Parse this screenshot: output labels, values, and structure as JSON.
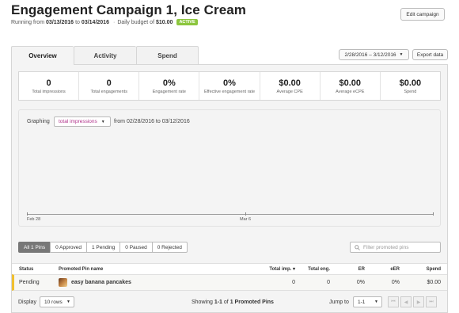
{
  "header": {
    "title": "Engagement Campaign 1, Ice Cream",
    "running_prefix": "Running from",
    "start_date": "03/13/2016",
    "to_word": "to",
    "end_date": "03/14/2016",
    "separator": "·",
    "budget_prefix": "Daily budget of",
    "budget": "$10.00",
    "status_badge": "ACTIVE",
    "edit_button": "Edit campaign"
  },
  "tabs": [
    {
      "label": "Overview",
      "active": true
    },
    {
      "label": "Activity",
      "active": false
    },
    {
      "label": "Spend",
      "active": false
    }
  ],
  "toolbar": {
    "date_range": "2/28/2016 – 3/12/2016",
    "export_button": "Export data"
  },
  "stats": [
    {
      "value": "0",
      "label": "Total impressions"
    },
    {
      "value": "0",
      "label": "Total engagements"
    },
    {
      "value": "0%",
      "label": "Engagement rate"
    },
    {
      "value": "0%",
      "label": "Effective engagement rate"
    },
    {
      "value": "$0.00",
      "label": "Average CPE"
    },
    {
      "value": "$0.00",
      "label": "Average eCPE"
    },
    {
      "value": "$0.00",
      "label": "Spend"
    }
  ],
  "graph": {
    "label": "Graphing",
    "metric": "total impressions",
    "range_text": "from 02/28/2016 to 03/12/2016",
    "x_ticks": [
      "Feb 28",
      "Mar 6"
    ]
  },
  "filters": {
    "buttons": [
      "All 1 Pins",
      "0 Approved",
      "1 Pending",
      "0 Paused",
      "0 Rejected"
    ],
    "search_placeholder": "Filter promoted pins"
  },
  "table": {
    "columns": [
      "Status",
      "Promoted Pin name",
      "Total imp. ▾",
      "Total eng.",
      "ER",
      "eER",
      "Spend"
    ],
    "rows": [
      {
        "status": "Pending",
        "name": "easy banana pancakes",
        "impressions": "0",
        "engagements": "0",
        "er": "0%",
        "eer": "0%",
        "spend": "$0.00"
      }
    ]
  },
  "footer": {
    "display_label": "Display",
    "rows_option": "10 rows",
    "showing_prefix": "Showing",
    "showing_range": "1-1",
    "showing_of": "of",
    "showing_count": "1",
    "showing_suffix": "Promoted Pins",
    "jump_label": "Jump to",
    "jump_option": "1-1",
    "pager_first": "⏮",
    "pager_prev": "◀",
    "pager_next": "▶",
    "pager_last": "⏭"
  },
  "colors": {
    "accent_metric": "#b0318a",
    "active_badge": "#8cc63e",
    "pending_marker": "#f0c030"
  }
}
